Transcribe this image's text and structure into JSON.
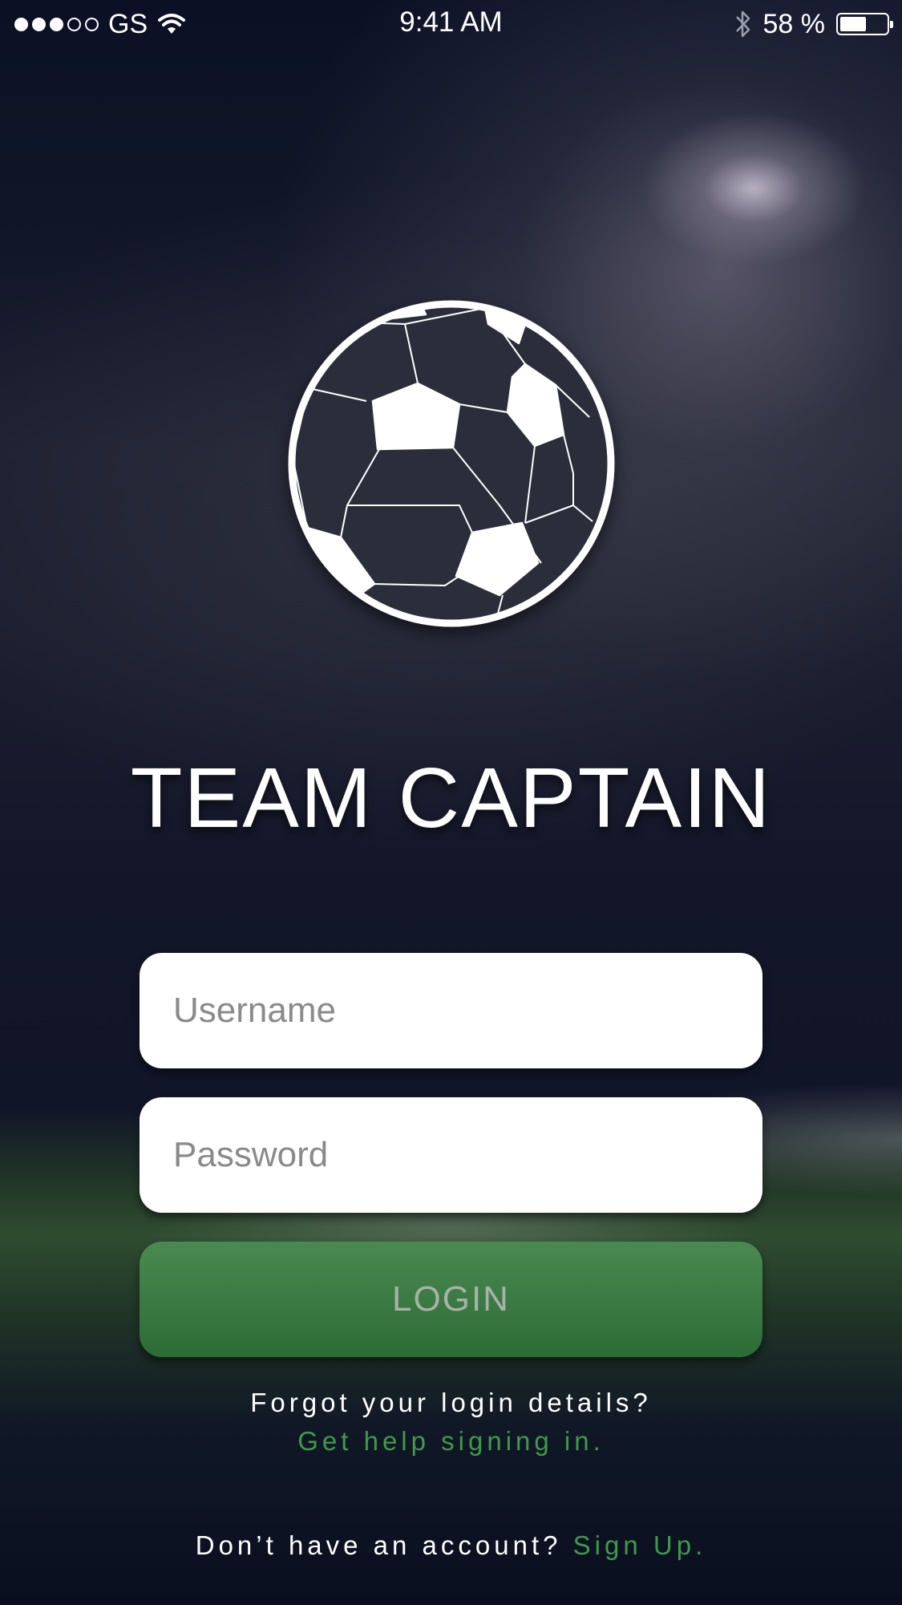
{
  "status_bar": {
    "carrier": "GS",
    "time": "9:41 AM",
    "battery_percent": "58 %",
    "battery_level": 0.58,
    "signal_bars_filled": 3,
    "signal_bars_total": 5
  },
  "app": {
    "title": "TEAM CAPTAIN"
  },
  "form": {
    "username_placeholder": "Username",
    "password_placeholder": "Password",
    "login_label": "LOGIN"
  },
  "help": {
    "forgot_text": "Forgot your login details?",
    "help_link": "Get help signing in."
  },
  "signup": {
    "prompt": "Don’t have an account?",
    "link": "Sign Up."
  },
  "colors": {
    "accent_green": "#3f9a48",
    "login_button": "#2d6b34",
    "background": "#0d1327"
  },
  "icons": [
    "signal-dots-icon",
    "wifi-icon",
    "bluetooth-icon",
    "battery-icon",
    "soccer-ball-logo"
  ]
}
